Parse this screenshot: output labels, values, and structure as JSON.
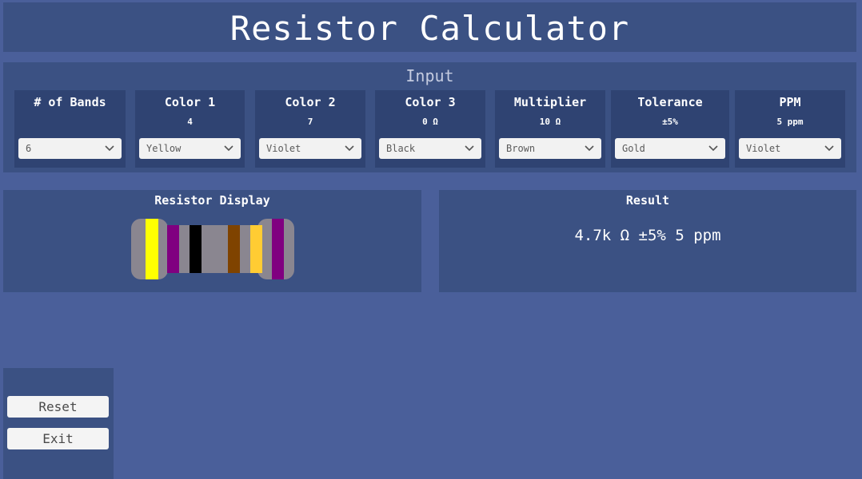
{
  "app": {
    "title": "Resistor Calculator"
  },
  "input": {
    "heading": "Input",
    "fields": [
      {
        "title": "# of Bands",
        "value": "",
        "selected": "6"
      },
      {
        "title": "Color 1",
        "value": "4",
        "selected": "Yellow"
      },
      {
        "title": "Color 2",
        "value": "7",
        "selected": "Violet"
      },
      {
        "title": "Color 3",
        "value": "0 Ω",
        "selected": "Black"
      },
      {
        "title": "Multiplier",
        "value": "10 Ω",
        "selected": "Brown"
      },
      {
        "title": "Tolerance",
        "value": "±5%",
        "selected": "Gold"
      },
      {
        "title": "PPM",
        "value": "5 ppm",
        "selected": "Violet"
      }
    ]
  },
  "display": {
    "title": "Resistor Display",
    "body_color": "#8a8690",
    "bands": [
      {
        "name": "Yellow",
        "color": "#ffff00"
      },
      {
        "name": "Violet",
        "color": "#800080"
      },
      {
        "name": "Black",
        "color": "#000000"
      },
      {
        "name": "Brown",
        "color": "#7f4300"
      },
      {
        "name": "Gold",
        "color": "#ffcc33"
      },
      {
        "name": "Violet",
        "color": "#800080"
      }
    ]
  },
  "result": {
    "title": "Result",
    "value": "4.7k Ω ±5% 5 ppm"
  },
  "controls": {
    "reset_label": "Reset",
    "exit_label": "Exit"
  },
  "colors": {
    "background": "#4a5f9a",
    "panel": "#3b5183",
    "card": "#2f4372"
  }
}
